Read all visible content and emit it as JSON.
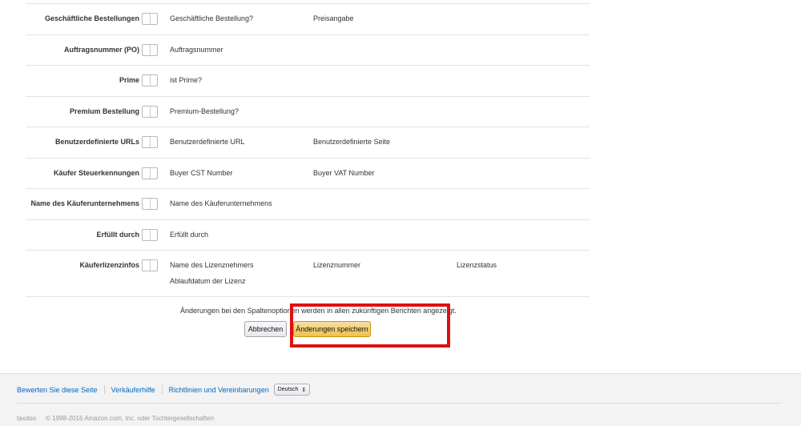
{
  "rows": [
    {
      "label": "Geschäftliche Bestellungen",
      "cols": [
        "Geschäftliche Bestellung?",
        "Preisangabe"
      ]
    },
    {
      "label": "Auftragsnummer (PO)",
      "cols": [
        "Auftragsnummer"
      ]
    },
    {
      "label": "Prime",
      "cols": [
        "ist Prime?"
      ]
    },
    {
      "label": "Premium Bestellung",
      "cols": [
        "Premium-Bestellung?"
      ]
    },
    {
      "label": "Benutzerdefinierte URLs",
      "cols": [
        "Benutzerdefinierte URL",
        "Benutzerdefinierte Seite"
      ]
    },
    {
      "label": "Käufer Steuerkennungen",
      "cols": [
        "Buyer CST Number",
        "Buyer VAT Number"
      ]
    },
    {
      "label": "Name des Käuferunternehmens",
      "cols": [
        "Name des Käuferunternehmens"
      ]
    },
    {
      "label": "Erfüllt durch",
      "cols": [
        "Erfüllt durch"
      ]
    },
    {
      "label": "Käuferlizenzinfos",
      "cols": [
        "Name des Lizenznehmers",
        "Lizenznummer",
        "Lizenzstatus",
        "Ablaufdatum der Lizenz"
      ]
    }
  ],
  "notice": "Änderungen bei den Spaltenoptionen werden in allen zukünftigen Berichten angezeigt.",
  "buttons": {
    "cancel": "Abbrechen",
    "save": "Änderungen speichern"
  },
  "footer": {
    "links": [
      "Bewerten Sie diese Seite",
      "Verkäuferhilfe",
      "Richtlinien und Vereinbarungen"
    ],
    "language": "Deutsch",
    "brand": "taxdoo",
    "copyright": "© 1998-2016 Amazon.com, Inc. oder Tochtergesellschaften"
  },
  "colors": {
    "highlight": "#e01010",
    "link": "#0066c0",
    "save_button": "#f0c14b"
  }
}
